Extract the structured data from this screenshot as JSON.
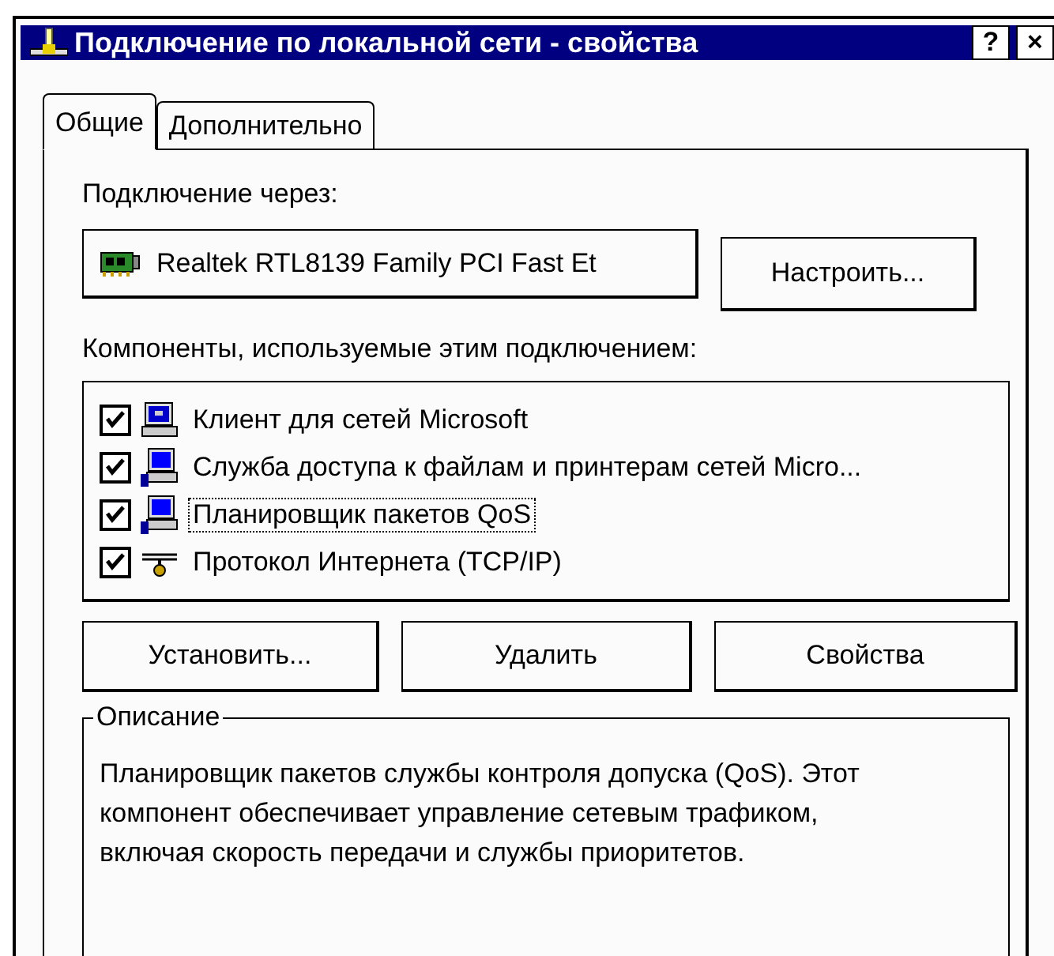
{
  "window": {
    "title": "Подключение по локальной сети - свойства",
    "buttons": [
      "?",
      "×"
    ]
  },
  "tabs": [
    {
      "label": "Общие",
      "selected": true
    },
    {
      "label": "Дополнительно",
      "selected": false
    }
  ],
  "connect_via": {
    "label": "Подключение через:",
    "adapter": "Realtek RTL8139 Family PCI Fast Et",
    "configure_button": "Настроить..."
  },
  "components": {
    "label": "Компоненты, используемые этим подключением:",
    "items": [
      {
        "kind": "client",
        "name": "Клиент для сетей Microsoft",
        "checked": true,
        "focused": false
      },
      {
        "kind": "service",
        "name": "Служба доступа к файлам и принтерам сетей Micro...",
        "checked": true,
        "focused": false
      },
      {
        "kind": "service",
        "name": "Планировщик пакетов QoS",
        "checked": true,
        "focused": true
      },
      {
        "kind": "protocol",
        "name": "Протокол Интернета (TCP/IP)",
        "checked": true,
        "focused": false
      }
    ]
  },
  "buttons": [
    "Установить...",
    "Удалить",
    "Свойства"
  ],
  "description": {
    "title": "Описание",
    "text": "Планировщик пакетов службы контроля допуска (QoS). Этот компонент обеспечивает управление сетевым трафиком, включая скорость передачи и службы приоритетов."
  }
}
